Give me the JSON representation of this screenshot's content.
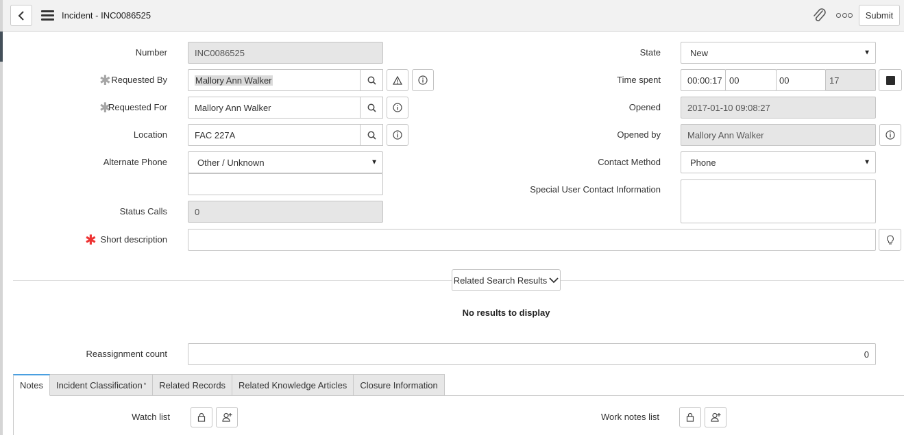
{
  "header": {
    "title": "Incident - INC0086525",
    "submit_label": "Submit"
  },
  "form": {
    "number": {
      "label": "Number",
      "value": "INC0086525"
    },
    "requested_by": {
      "label": "Requested By",
      "value": "Mallory Ann Walker"
    },
    "requested_for": {
      "label": "Requested For",
      "value": "Mallory Ann Walker"
    },
    "location": {
      "label": "Location",
      "value": "FAC 227A"
    },
    "alternate_phone": {
      "label": "Alternate Phone",
      "selected": "Other / Unknown",
      "extra_value": ""
    },
    "status_calls": {
      "label": "Status Calls",
      "value": "0"
    },
    "short_description": {
      "label": "Short description",
      "value": ""
    },
    "state": {
      "label": "State",
      "selected": "New"
    },
    "time_spent": {
      "label": "Time spent",
      "total": "00:00:17",
      "hours": "00",
      "minutes": "00",
      "seconds": "17"
    },
    "opened": {
      "label": "Opened",
      "value": "2017-01-10 09:08:27"
    },
    "opened_by": {
      "label": "Opened by",
      "value": "Mallory Ann Walker"
    },
    "contact_method": {
      "label": "Contact Method",
      "selected": "Phone"
    },
    "special_contact": {
      "label": "Special User Contact Information",
      "value": ""
    },
    "reassignment_count": {
      "label": "Reassignment count",
      "value": "0"
    }
  },
  "related_search": {
    "button_label": "Related Search Results",
    "empty_text": "No results to display"
  },
  "tabs": [
    {
      "label": "Notes",
      "active": true,
      "mandatory": false
    },
    {
      "label": "Incident Classification",
      "active": false,
      "mandatory": true,
      "marker": "*"
    },
    {
      "label": "Related Records",
      "active": false,
      "mandatory": false
    },
    {
      "label": "Related Knowledge Articles",
      "active": false,
      "mandatory": false
    },
    {
      "label": "Closure Information",
      "active": false,
      "mandatory": false
    }
  ],
  "notes": {
    "watch_list_label": "Watch list",
    "work_notes_list_label": "Work notes list"
  },
  "icons": {
    "back": "chevron-left-icon",
    "menu": "hamburger-icon",
    "attachment": "paperclip-icon",
    "more": "more-options-icon",
    "lookup": "search-icon",
    "warning": "warning-icon",
    "info": "info-icon",
    "stop": "stop-icon",
    "lightbulb": "lightbulb-icon",
    "lock": "lock-icon",
    "add_me": "add-me-icon"
  },
  "colors": {
    "header_bg": "#f2f2f2",
    "readonly_bg": "#e6e6e6",
    "mandatory_red": "#ee3333",
    "active_tab_accent": "#4a9fe0"
  }
}
